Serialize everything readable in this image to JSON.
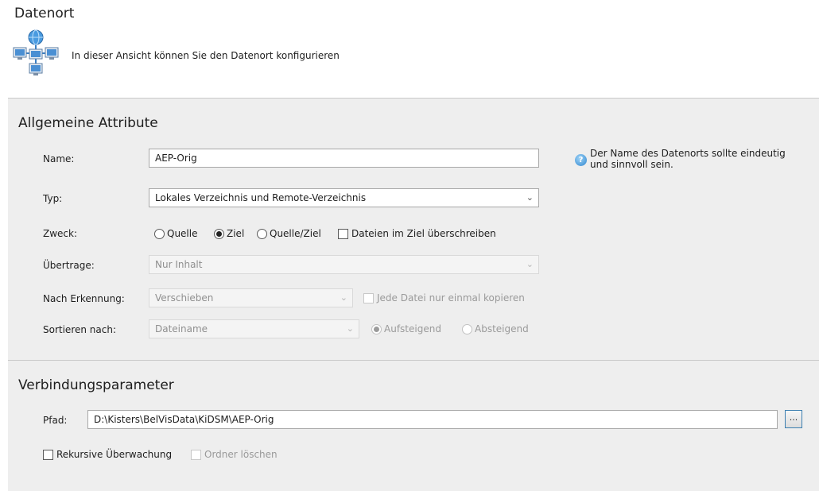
{
  "header": {
    "title": "Datenort",
    "description": "In dieser Ansicht können Sie den Datenort konfigurieren",
    "icon": "network-computers-icon"
  },
  "general": {
    "title": "Allgemeine Attribute",
    "name_label": "Name:",
    "name_value": "AEP-Orig",
    "hint_icon": "help-icon",
    "hint": "Der Name des Datenorts sollte eindeutig und sinnvoll sein.",
    "type_label": "Typ:",
    "type_value": "Lokales Verzeichnis und Remote-Verzeichnis",
    "purpose_label": "Zweck:",
    "purpose_options": [
      {
        "label": "Quelle",
        "selected": false
      },
      {
        "label": "Ziel",
        "selected": true
      },
      {
        "label": "Quelle/Ziel",
        "selected": false
      }
    ],
    "overwrite_label": "Dateien im Ziel überschreiben",
    "overwrite_checked": false,
    "transfer_label": "Übertrage:",
    "transfer_value": "Nur Inhalt",
    "after_detect_label": "Nach Erkennung:",
    "after_detect_value": "Verschieben",
    "copy_once_label": "Jede Datei nur einmal kopieren",
    "copy_once_checked": false,
    "sort_label": "Sortieren nach:",
    "sort_value": "Dateiname",
    "sort_options": [
      {
        "label": "Aufsteigend",
        "selected": true
      },
      {
        "label": "Absteigend",
        "selected": false
      }
    ]
  },
  "connection": {
    "title": "Verbindungsparameter",
    "path_label": "Pfad:",
    "path_value": "D:\\Kisters\\BelVisData\\KiDSM\\AEP-Orig",
    "browse_label": "...",
    "recursive_label": "Rekursive Überwachung",
    "recursive_checked": false,
    "delete_folder_label": "Ordner löschen",
    "delete_folder_checked": false
  }
}
